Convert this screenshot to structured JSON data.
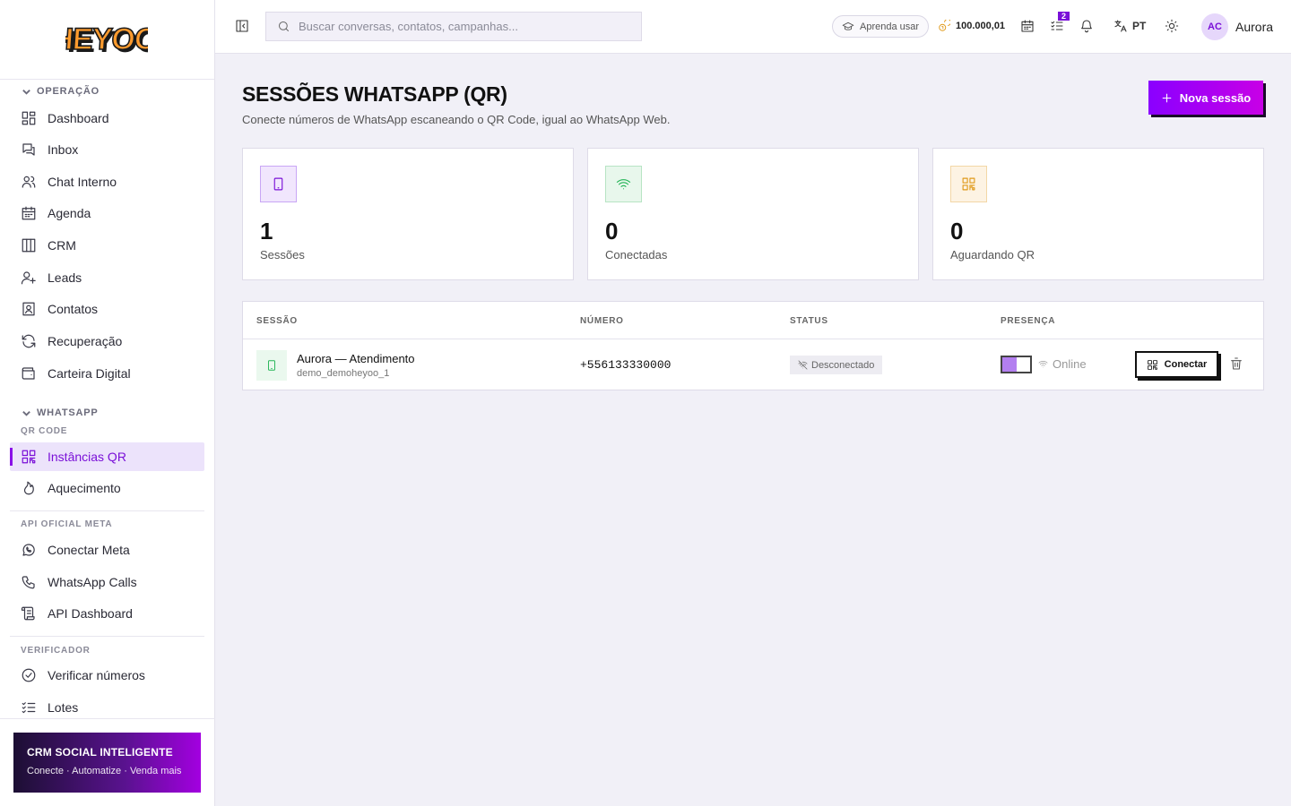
{
  "brand": {
    "logo_text": "HEYOO"
  },
  "header": {
    "search_placeholder": "Buscar conversas, contatos, campanhas...",
    "learn_label": "Aprenda usar",
    "credits": "100.000,01",
    "tasks_badge": "2",
    "language": "PT",
    "user_initials": "AC",
    "user_name": "Aurora"
  },
  "sidebar": {
    "operacao": {
      "title": "OPERAÇÃO",
      "items": [
        {
          "label": "Dashboard",
          "icon": "dashboard-icon"
        },
        {
          "label": "Inbox",
          "icon": "inbox-icon"
        },
        {
          "label": "Chat Interno",
          "icon": "users-icon"
        },
        {
          "label": "Agenda",
          "icon": "calendar-icon"
        },
        {
          "label": "CRM",
          "icon": "kanban-icon"
        },
        {
          "label": "Leads",
          "icon": "user-plus-icon"
        },
        {
          "label": "Contatos",
          "icon": "contact-icon"
        },
        {
          "label": "Recuperação",
          "icon": "refresh-icon"
        },
        {
          "label": "Carteira Digital",
          "icon": "wallet-icon"
        }
      ]
    },
    "whatsapp": {
      "title": "WHATSAPP",
      "qr_title": "QR CODE",
      "qr_items": [
        {
          "label": "Instâncias QR",
          "icon": "qr-icon",
          "active": true
        },
        {
          "label": "Aquecimento",
          "icon": "flame-icon"
        }
      ],
      "meta_title": "API OFICIAL META",
      "meta_items": [
        {
          "label": "Conectar Meta",
          "icon": "whatsapp-icon"
        },
        {
          "label": "WhatsApp Calls",
          "icon": "phone-icon"
        },
        {
          "label": "API Dashboard",
          "icon": "scroll-icon"
        }
      ],
      "verif_title": "VERIFICADOR",
      "verif_items": [
        {
          "label": "Verificar números",
          "icon": "check-circle-icon"
        },
        {
          "label": "Lotes",
          "icon": "list-check-icon"
        }
      ]
    },
    "promo": {
      "title": "CRM SOCIAL INTELIGENTE",
      "subtitle": "Conecte · Automatize · Venda mais"
    }
  },
  "page": {
    "title": "SESSÕES WHATSAPP (QR)",
    "subtitle": "Conecte números de WhatsApp escaneando o QR Code, igual ao WhatsApp Web.",
    "new_button": "Nova sessão"
  },
  "stats": [
    {
      "value": "1",
      "label": "Sessões",
      "icon": "tablet-icon",
      "color": "#7a10d8"
    },
    {
      "value": "0",
      "label": "Conectadas",
      "icon": "wifi-icon",
      "color": "#22b455"
    },
    {
      "value": "0",
      "label": "Aguardando QR",
      "icon": "qr-icon",
      "color": "#e09a1a"
    }
  ],
  "table": {
    "columns": [
      "SESSÃO",
      "NÚMERO",
      "STATUS",
      "PRESENÇA"
    ],
    "rows": [
      {
        "name": "Aurora — Atendimento",
        "id": "demo_demoheyoo_1",
        "number": "+556133330000",
        "status": "Desconectado",
        "presence": "Online",
        "presence_on": true,
        "connect_label": "Conectar"
      }
    ]
  }
}
